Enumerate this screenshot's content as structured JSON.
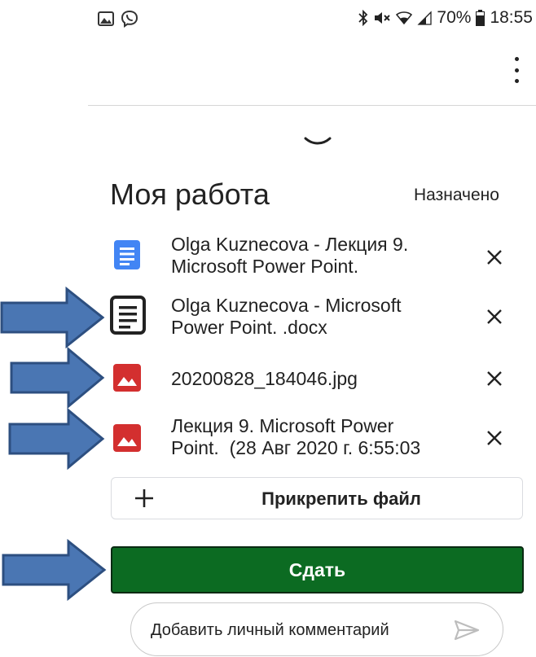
{
  "status_bar": {
    "battery_level": "70%",
    "time": "18:55",
    "left_icons": [
      "image-icon",
      "viber-icon"
    ],
    "right_icons": [
      "bluetooth-icon",
      "mute-icon",
      "wifi-icon",
      "signal-icon",
      "battery-icon"
    ]
  },
  "header": {
    "title": "Моя работа",
    "status": "Назначено"
  },
  "attachments": [
    {
      "icon": "google-docs-icon",
      "name_line1": "Olga Kuznecova - Лекция 9.",
      "name_line2": "Microsoft Power Point."
    },
    {
      "icon": "document-icon",
      "name_line1": "Olga Kuznecova - Microsoft",
      "name_line2": "Power Point. .docx"
    },
    {
      "icon": "image-file-icon",
      "name_line1": "20200828_184046.jpg",
      "name_line2": ""
    },
    {
      "icon": "image-file-icon",
      "name_line1": "Лекция 9. Microsoft Power",
      "name_line2": "Point.  (28 Авг 2020 г. 6:55:03"
    }
  ],
  "attach_button": {
    "label": "Прикрепить файл"
  },
  "submit_button": {
    "label": "Сдать"
  },
  "comment": {
    "placeholder": "Добавить личный комментарий",
    "value": ""
  },
  "colors": {
    "submit_bg": "#0c6b22",
    "arrow_fill": "#4a76b3",
    "docs_blue": "#4285f4",
    "image_red": "#d32f2f"
  }
}
